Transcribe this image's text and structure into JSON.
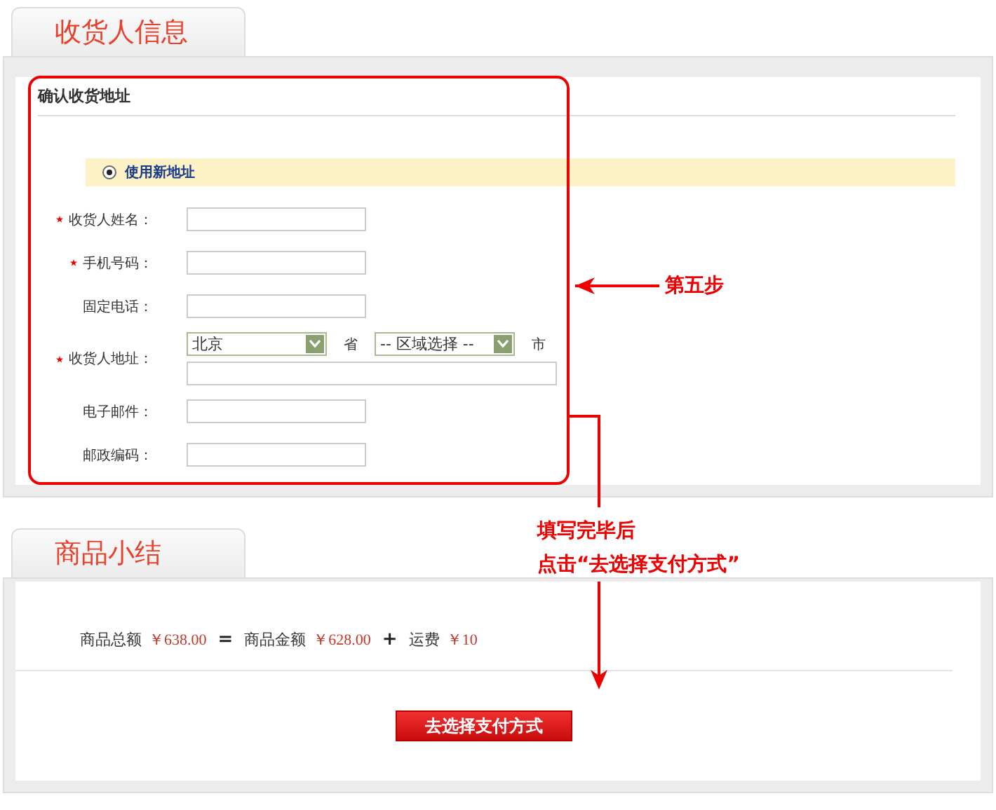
{
  "consignee": {
    "tab": "收货人信息",
    "heading": "确认收货地址",
    "address_option": {
      "label": "使用新地址",
      "selected": true
    },
    "fields": [
      {
        "kind": "text",
        "label": "收货人姓名：",
        "required": true
      },
      {
        "kind": "text",
        "label": "手机号码：",
        "required": true
      },
      {
        "kind": "text",
        "label": "固定电话：",
        "required": false
      },
      {
        "kind": "address",
        "label": "收货人地址：",
        "required": true,
        "province": "北京",
        "province_unit": "省",
        "city": "-- 区域选择 --",
        "city_unit": "市"
      },
      {
        "kind": "text",
        "label": "电子邮件：",
        "required": false
      },
      {
        "kind": "text",
        "label": "邮政编码：",
        "required": false
      }
    ]
  },
  "summary": {
    "tab": "商品小结",
    "parts": [
      {
        "kind": "label",
        "text": "商品总额"
      },
      {
        "kind": "amount",
        "text": "￥638.00"
      },
      {
        "kind": "operator",
        "text": "="
      },
      {
        "kind": "label",
        "text": "商品金额"
      },
      {
        "kind": "amount",
        "text": "￥628.00"
      },
      {
        "kind": "operator",
        "text": "+"
      },
      {
        "kind": "label",
        "text": "运费"
      },
      {
        "kind": "amount",
        "text": "￥10"
      }
    ],
    "button": "去选择支付方式"
  },
  "annotations": {
    "step": "第五步",
    "note_lines": [
      "填写完毕后",
      "点击“去选择支付方式”"
    ]
  }
}
